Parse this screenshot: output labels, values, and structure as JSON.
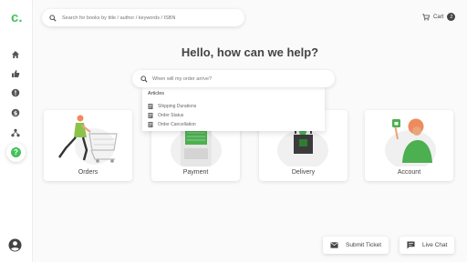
{
  "brand": {
    "logo": "c."
  },
  "sidebar": {
    "items": [
      {
        "icon": "home-icon"
      },
      {
        "icon": "thumbs-up-icon"
      },
      {
        "icon": "alert-icon"
      },
      {
        "icon": "dollar-icon"
      },
      {
        "icon": "network-icon"
      },
      {
        "icon": "help-icon",
        "active": true,
        "glyph": "?"
      }
    ],
    "profile_icon": "account-circle-icon"
  },
  "header": {
    "search_placeholder": "Search for books by title / author / keywords / ISBN",
    "cart_label": "Cart",
    "cart_count": "2"
  },
  "main": {
    "headline": "Hello, how can we help?",
    "help_search_placeholder": "When will my order arrive?",
    "suggestions": {
      "title": "Articles",
      "items": [
        "Shipping Durations",
        "Order Status",
        "Order Cancellation"
      ]
    },
    "cards": [
      {
        "label": "Orders"
      },
      {
        "label": "Payment"
      },
      {
        "label": "Delivery"
      },
      {
        "label": "Account"
      }
    ]
  },
  "footer": {
    "submit_ticket": "Submit Ticket",
    "live_chat": "Live Chat"
  },
  "colors": {
    "accent": "#44c25a",
    "text": "#444444",
    "illustration_orange": "#f08a5d"
  }
}
